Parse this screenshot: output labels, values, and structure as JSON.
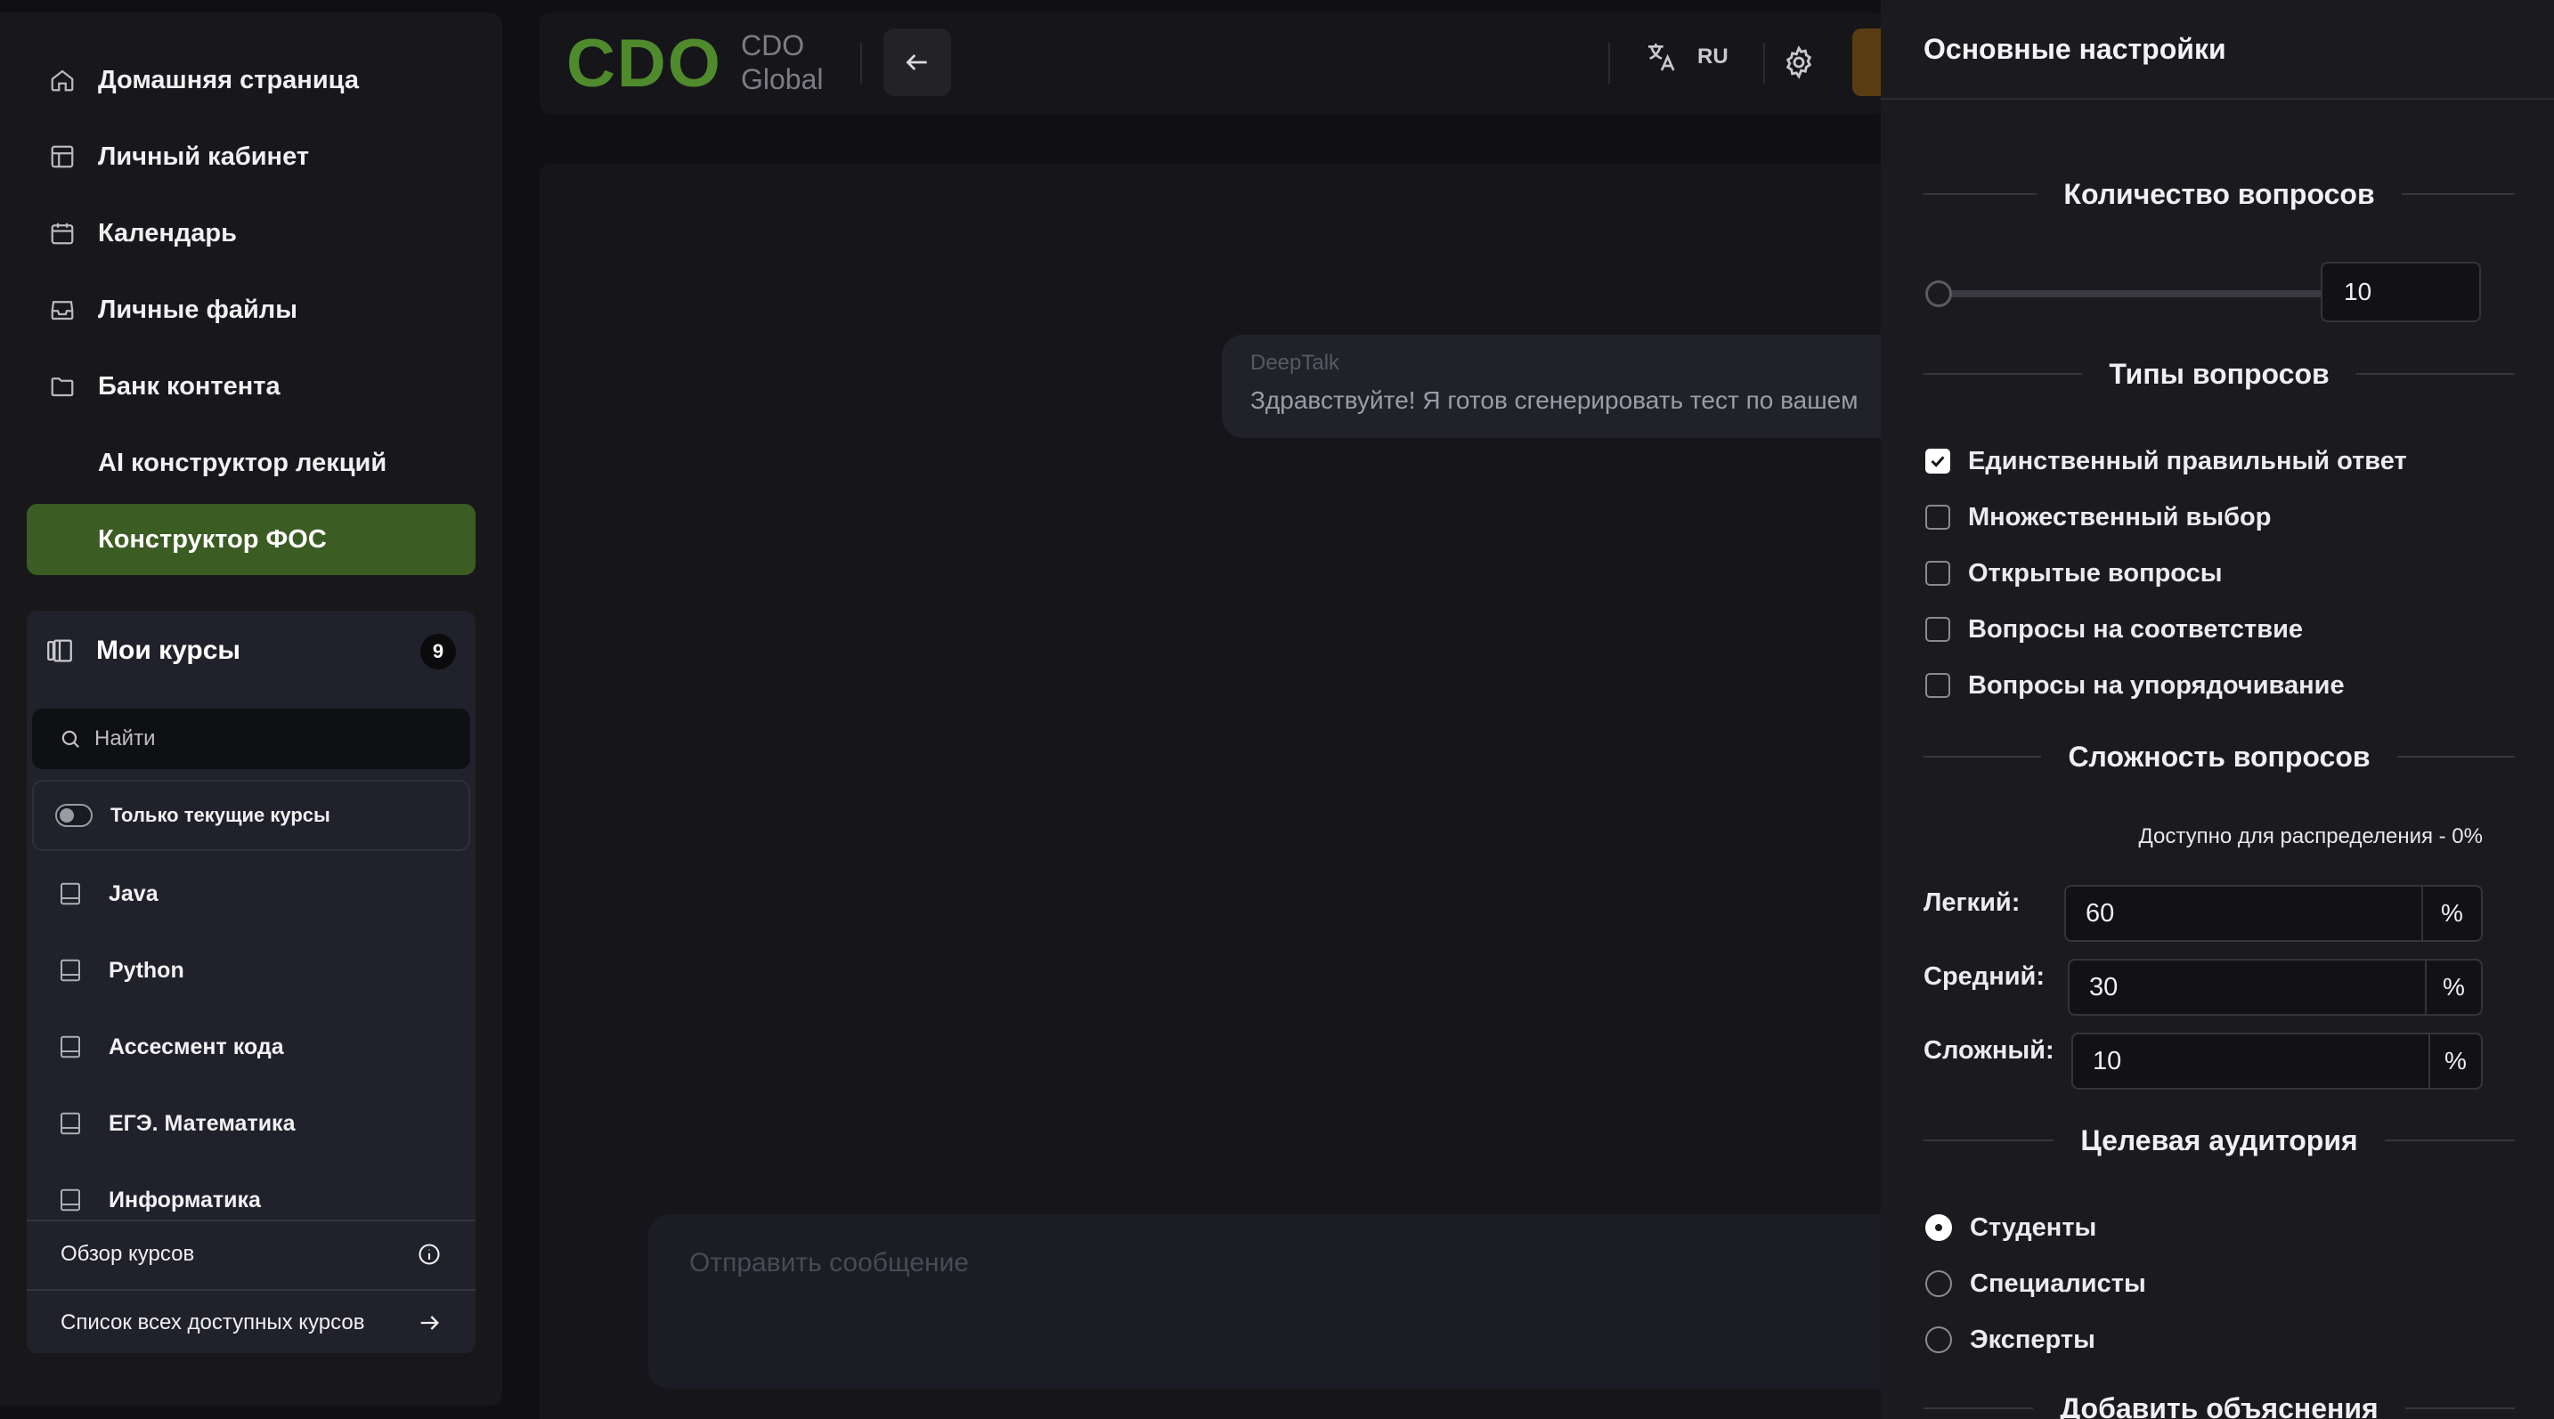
{
  "sidebar": {
    "nav": [
      {
        "label": "Домашняя страница",
        "icon": "home-icon"
      },
      {
        "label": "Личный кабинет",
        "icon": "layout-icon"
      },
      {
        "label": "Календарь",
        "icon": "calendar-icon"
      },
      {
        "label": "Личные файлы",
        "icon": "inbox-icon"
      },
      {
        "label": "Банк контента",
        "icon": "folder-icon"
      },
      {
        "label": "AI конструктор лекций",
        "icon": ""
      },
      {
        "label": "Конструктор ФОС",
        "icon": ""
      }
    ],
    "courses": {
      "title": "Мои курсы",
      "count": "9",
      "search_placeholder": "Найти",
      "toggle_label": "Только текущие курсы",
      "items": [
        "Java",
        "Python",
        "Ассесмент кода",
        "ЕГЭ. Математика",
        "Информатика"
      ],
      "overview_label": "Обзор курсов",
      "all_courses_label": "Список всех доступных курсов"
    }
  },
  "header": {
    "logo_mark": "CDO",
    "logo_line1": "CDO",
    "logo_line2": "Global",
    "language": "RU"
  },
  "chat": {
    "sender": "DeepTalk",
    "message": "Здравствуйте! Я готов сгенерировать тест по вашем",
    "input_placeholder": "Отправить сообщение"
  },
  "settings": {
    "title": "Основные настройки",
    "count_section": "Количество вопросов",
    "question_count": "10",
    "types_section": "Типы вопросов",
    "types": [
      {
        "label": "Единственный правильный ответ",
        "checked": true
      },
      {
        "label": "Множественный выбор",
        "checked": false
      },
      {
        "label": "Открытые вопросы",
        "checked": false
      },
      {
        "label": "Вопросы на соответствие",
        "checked": false
      },
      {
        "label": "Вопросы на упорядочивание",
        "checked": false
      }
    ],
    "difficulty_section": "Сложность вопросов",
    "available_text": "Доступно для распределения - 0%",
    "difficulty": [
      {
        "label": "Легкий:",
        "value": "60",
        "unit": "%"
      },
      {
        "label": "Средний:",
        "value": "30",
        "unit": "%"
      },
      {
        "label": "Сложный:",
        "value": "10",
        "unit": "%"
      }
    ],
    "audience_section": "Целевая аудитория",
    "audience": [
      {
        "label": "Студенты",
        "selected": true
      },
      {
        "label": "Специалисты",
        "selected": false
      },
      {
        "label": "Эксперты",
        "selected": false
      }
    ],
    "explanations_section": "Добавить объяснения"
  },
  "colors": {
    "accent_green": "#3b5c23",
    "logo_green": "#4f8a2c",
    "panel_bg": "#1b1b1f"
  }
}
